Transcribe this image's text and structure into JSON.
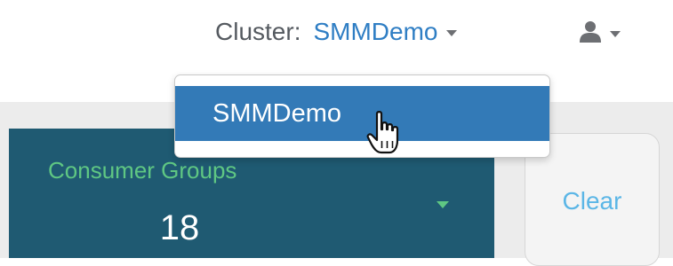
{
  "header": {
    "cluster_label": "Cluster:",
    "cluster_value": "SMMDemo",
    "user_icon": "user-icon"
  },
  "dropdown": {
    "items": [
      {
        "label": "SMMDemo",
        "selected": true
      }
    ]
  },
  "stat_tile": {
    "label": "Consumer Groups",
    "value": "18",
    "caret_icon": "caret-down-icon"
  },
  "clear_button": {
    "label": "Clear"
  },
  "cursor": {
    "icon": "hand-pointer-icon"
  },
  "colors": {
    "accent_link": "#2f7ec4",
    "tile_background": "#1f5a72",
    "tile_label": "#5fc783",
    "dropdown_selected": "#337ab7",
    "clear_text": "#5bb6e6"
  }
}
